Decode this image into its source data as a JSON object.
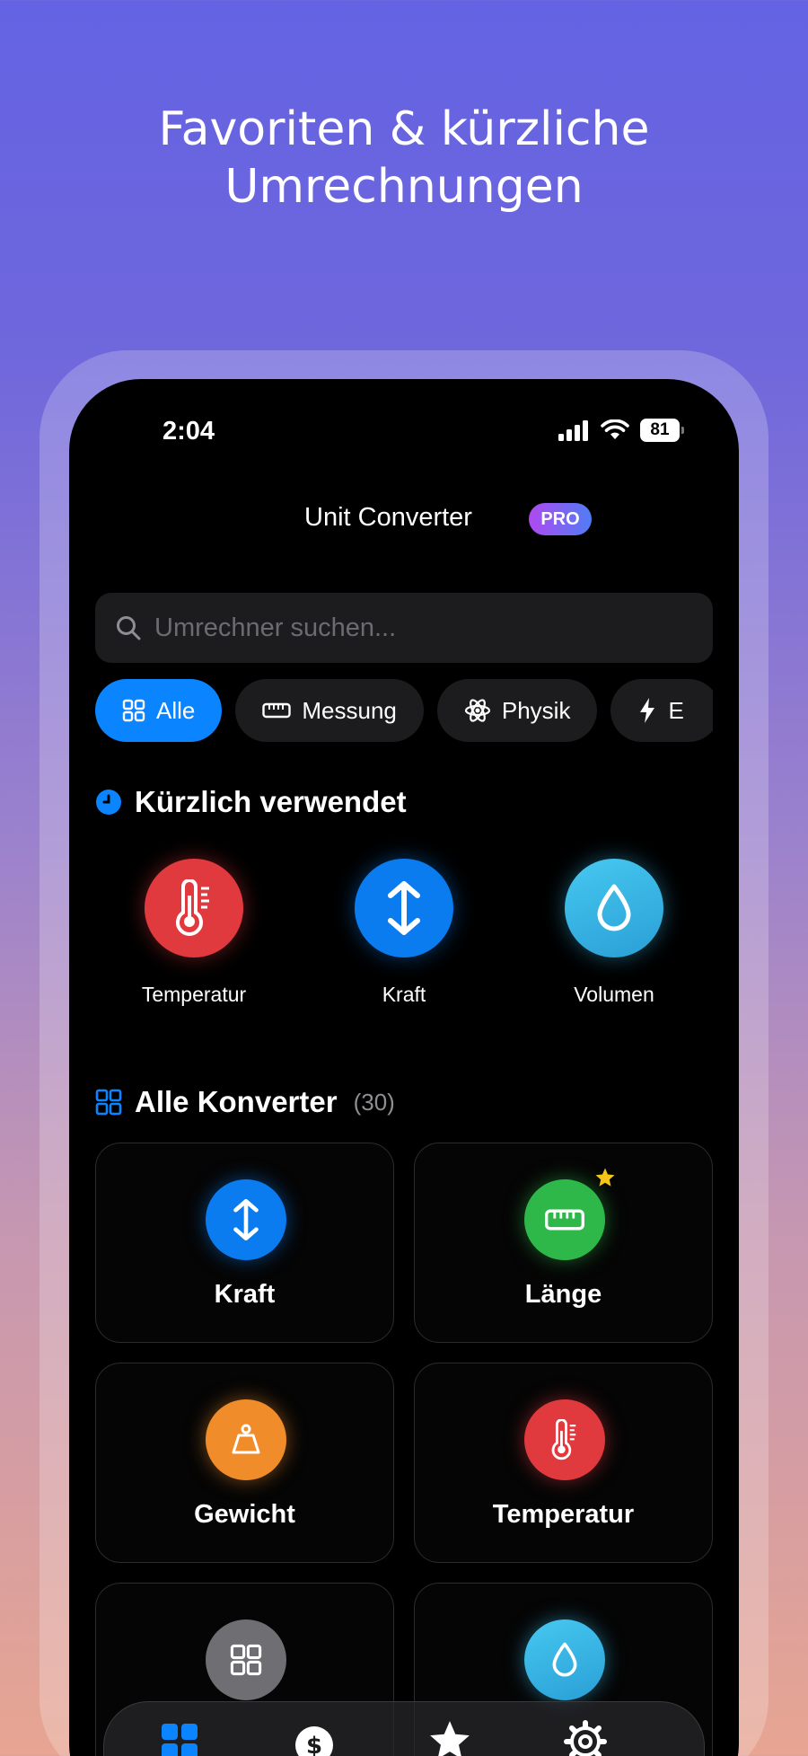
{
  "headline": {
    "line1": "Favoriten & kürzliche",
    "line2": "Umrechnungen"
  },
  "status": {
    "time": "2:04",
    "battery": "81"
  },
  "app": {
    "title": "Unit Converter",
    "badge": "PRO"
  },
  "search": {
    "placeholder": "Umrechner suchen..."
  },
  "chips": [
    {
      "label": "Alle",
      "icon": "grid-icon",
      "active": true
    },
    {
      "label": "Messung",
      "icon": "ruler-icon"
    },
    {
      "label": "Physik",
      "icon": "atom-icon"
    },
    {
      "label": "E",
      "icon": "bolt-icon"
    }
  ],
  "recent": {
    "title": "Kürzlich verwendet",
    "items": [
      {
        "label": "Temperatur",
        "icon": "thermometer-icon",
        "color": "#e03a3f"
      },
      {
        "label": "Kraft",
        "icon": "arrows-vertical-icon",
        "color": "#0a7cf0"
      },
      {
        "label": "Volumen",
        "icon": "drop-icon",
        "color": "#33b6e6"
      }
    ]
  },
  "all": {
    "title": "Alle Konverter",
    "count": "(30)",
    "cards": [
      {
        "label": "Kraft",
        "icon": "arrows-vertical-icon",
        "color": "#0a7cf0",
        "favorite": false
      },
      {
        "label": "Länge",
        "icon": "ruler-icon",
        "color": "#2fb84a",
        "favorite": true
      },
      {
        "label": "Gewicht",
        "icon": "weight-icon",
        "color": "#f08c2a",
        "favorite": false
      },
      {
        "label": "Temperatur",
        "icon": "thermometer-icon",
        "color": "#e03a3f",
        "favorite": false
      },
      {
        "label": "",
        "icon": "grid-icon",
        "color": "#6e6e73",
        "favorite": false
      },
      {
        "label": "",
        "icon": "drop-icon",
        "color": "#33b6e6",
        "favorite": false
      }
    ]
  },
  "tabbar": [
    {
      "icon": "grid-icon",
      "active": true
    },
    {
      "icon": "dollar-icon"
    },
    {
      "icon": "star-icon"
    },
    {
      "icon": "gear-icon"
    }
  ],
  "colors": {
    "accent": "#0a84ff",
    "star": "#f5c518"
  }
}
